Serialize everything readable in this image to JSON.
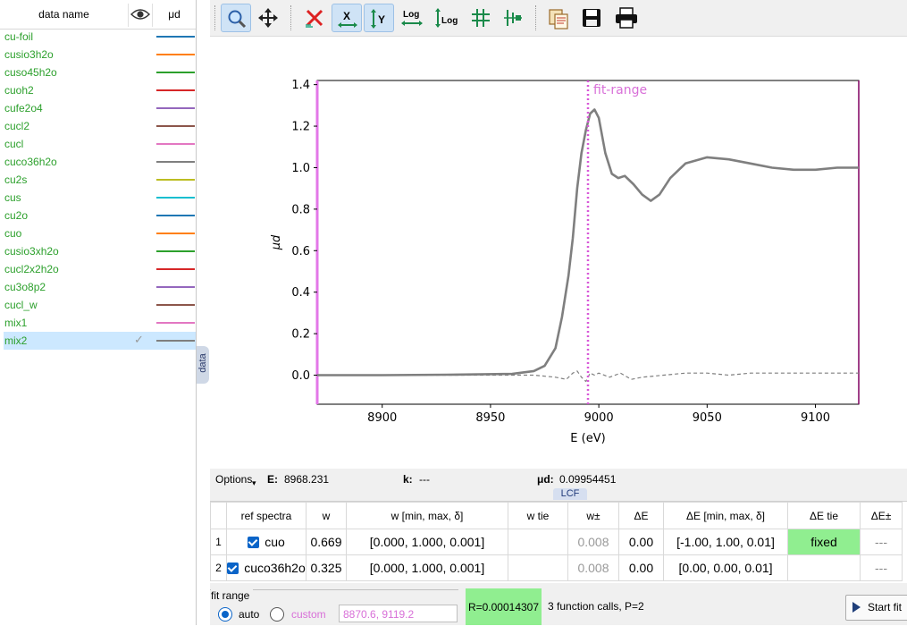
{
  "left_panel": {
    "header": {
      "name": "data name",
      "visibility_icon": "eye-icon",
      "column": "μd"
    },
    "items": [
      {
        "label": "cu-foil",
        "color": "#1f77b4"
      },
      {
        "label": "cusio3h2o",
        "color": "#ff7f0e"
      },
      {
        "label": "cuso45h2o",
        "color": "#2ca02c"
      },
      {
        "label": "cuoh2",
        "color": "#d62728"
      },
      {
        "label": "cufe2o4",
        "color": "#9467bd"
      },
      {
        "label": "cucl2",
        "color": "#8c564b"
      },
      {
        "label": "cucl",
        "color": "#e377c2"
      },
      {
        "label": "cuco36h2o",
        "color": "#7f7f7f"
      },
      {
        "label": "cu2s",
        "color": "#bcbd22"
      },
      {
        "label": "cus",
        "color": "#17becf"
      },
      {
        "label": "cu2o",
        "color": "#1f77b4"
      },
      {
        "label": "cuo",
        "color": "#ff7f0e"
      },
      {
        "label": "cusio3xh2o",
        "color": "#2ca02c"
      },
      {
        "label": "cucl2x2h2o",
        "color": "#d62728"
      },
      {
        "label": "cu3o8p2",
        "color": "#9467bd"
      },
      {
        "label": "cucl_w",
        "color": "#8c564b"
      },
      {
        "label": "mix1",
        "color": "#e377c2"
      },
      {
        "label": "mix2",
        "color": "#7f7f7f",
        "selected": true
      }
    ],
    "side_tab": "data"
  },
  "toolbar": {
    "buttons": [
      {
        "name": "zoom",
        "icon": "magnifier-icon",
        "active": true
      },
      {
        "name": "pan",
        "icon": "move-arrows-icon"
      },
      {
        "name": "autoscale",
        "icon": "red-x-icon"
      },
      {
        "name": "x-autoscale",
        "icon": "x-arrows-icon",
        "active": true
      },
      {
        "name": "y-autoscale",
        "icon": "y-arrows-icon",
        "active": true
      },
      {
        "name": "x-log",
        "icon": "log-x-icon"
      },
      {
        "name": "y-log",
        "icon": "log-y-icon"
      },
      {
        "name": "grid",
        "icon": "grid-icon"
      },
      {
        "name": "legend",
        "icon": "legend-icon"
      },
      {
        "name": "copy",
        "icon": "copy-clipboard-icon"
      },
      {
        "name": "save",
        "icon": "floppy-icon"
      },
      {
        "name": "print",
        "icon": "printer-icon"
      }
    ],
    "log_text": "Log",
    "x_text": "X",
    "y_text": "Y"
  },
  "chart_data": {
    "type": "line",
    "xlabel": "E (eV)",
    "ylabel": "μd",
    "xlim": [
      8870,
      9120
    ],
    "ylim": [
      -0.14,
      1.42
    ],
    "xticks": [
      8900,
      8950,
      9000,
      9050,
      9100
    ],
    "yticks": [
      0.0,
      0.2,
      0.4,
      0.6,
      0.8,
      1.0,
      1.2,
      1.4
    ],
    "annotation": "fit-range",
    "fit_range_marker_x": 8995,
    "series": [
      {
        "color": "#7f7f7f",
        "style": "solid",
        "x": [
          8870,
          8900,
          8930,
          8960,
          8970,
          8975,
          8980,
          8983,
          8986,
          8988,
          8990,
          8992,
          8994,
          8996,
          8998,
          9000,
          9003,
          9006,
          9009,
          9012,
          9016,
          9020,
          9024,
          9028,
          9033,
          9040,
          9050,
          9060,
          9070,
          9080,
          9090,
          9100,
          9110,
          9120
        ],
        "y": [
          0.0,
          0.0,
          0.002,
          0.006,
          0.02,
          0.045,
          0.13,
          0.28,
          0.48,
          0.66,
          0.9,
          1.07,
          1.18,
          1.26,
          1.28,
          1.24,
          1.07,
          0.97,
          0.95,
          0.96,
          0.92,
          0.87,
          0.84,
          0.87,
          0.95,
          1.02,
          1.05,
          1.04,
          1.02,
          1.0,
          0.99,
          0.99,
          1.0,
          1.0
        ]
      },
      {
        "color": "#7f7f7f",
        "style": "dashed",
        "x": [
          8870,
          8940,
          8970,
          8980,
          8985,
          8988,
          8990,
          8992,
          8994,
          8996,
          8998,
          9000,
          9005,
          9010,
          9015,
          9020,
          9030,
          9040,
          9050,
          9060,
          9070,
          9090,
          9110,
          9120
        ],
        "y": [
          0.0,
          0.0,
          0.0,
          -0.01,
          -0.02,
          0.01,
          0.02,
          -0.01,
          -0.03,
          0.01,
          0.0,
          0.01,
          -0.01,
          0.01,
          -0.02,
          -0.01,
          0.0,
          0.01,
          0.01,
          0.0,
          0.01,
          0.01,
          0.01,
          0.01
        ]
      }
    ]
  },
  "status": {
    "options": "Options",
    "e_label": "E:",
    "e_value": "8968.231",
    "k_label": "k:",
    "k_value": "---",
    "mu_label": "μd:",
    "mu_value": "0.09954451",
    "tab": "LCF"
  },
  "table": {
    "headers": [
      "ref spectra",
      "w",
      "w [min, max, δ]",
      "w tie",
      "w±",
      "ΔE",
      "ΔE [min, max, δ]",
      "ΔE tie",
      "ΔE±"
    ],
    "rows": [
      {
        "idx": "1",
        "ref": "cuo",
        "w": "0.669",
        "w_range": "[0.000, 1.000, 0.001]",
        "w_tie": "",
        "w_pm": "0.008",
        "de": "0.00",
        "de_range": "[-1.00, 1.00, 0.01]",
        "de_tie": "fixed",
        "de_pm": "---"
      },
      {
        "idx": "2",
        "ref": "cuco36h2o",
        "w": "0.325",
        "w_range": "[0.000, 1.000, 0.001]",
        "w_tie": "",
        "w_pm": "0.008",
        "de": "0.00",
        "de_range": "[0.00, 0.00, 0.01]",
        "de_tie": "",
        "de_pm": "---"
      }
    ]
  },
  "fit": {
    "group_title": "fit range",
    "auto_label": "auto",
    "custom_label": "custom",
    "range_value": "8870.6, 9119.2",
    "r_text": "R=0.00014307",
    "calls_text": "3 function calls, P=2",
    "start_label": "Start fit",
    "colors": {
      "green": "#90ee90",
      "custom_pink": "#d870d8"
    }
  }
}
